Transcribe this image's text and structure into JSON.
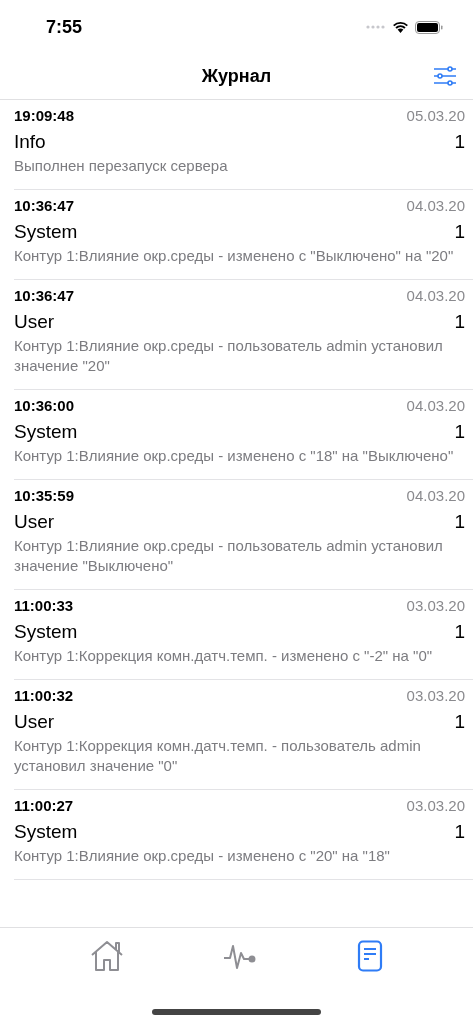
{
  "status_bar": {
    "time": "7:55"
  },
  "nav": {
    "title": "Журнал"
  },
  "entries": [
    {
      "time": "19:09:48",
      "date": "05.03.20",
      "category": "Info",
      "count": "1",
      "message": "Выполнен перезапуск сервера"
    },
    {
      "time": "10:36:47",
      "date": "04.03.20",
      "category": "System",
      "count": "1",
      "message": "Контур 1:Влияние окр.среды - изменено с \"Выключено\" на \"20\""
    },
    {
      "time": "10:36:47",
      "date": "04.03.20",
      "category": "User",
      "count": "1",
      "message": "Контур 1:Влияние окр.среды - пользователь admin установил значение \"20\""
    },
    {
      "time": "10:36:00",
      "date": "04.03.20",
      "category": "System",
      "count": "1",
      "message": "Контур 1:Влияние окр.среды - изменено с \"18\" на \"Выключено\""
    },
    {
      "time": "10:35:59",
      "date": "04.03.20",
      "category": "User",
      "count": "1",
      "message": "Контур 1:Влияние окр.среды - пользователь admin установил значение \"Выключено\""
    },
    {
      "time": "11:00:33",
      "date": "03.03.20",
      "category": "System",
      "count": "1",
      "message": "Контур 1:Коррекция комн.датч.темп. - изменено с \"-2\" на \"0\""
    },
    {
      "time": "11:00:32",
      "date": "03.03.20",
      "category": "User",
      "count": "1",
      "message": "Контур 1:Коррекция комн.датч.темп. - пользователь admin установил значение \"0\""
    },
    {
      "time": "11:00:27",
      "date": "03.03.20",
      "category": "System",
      "count": "1",
      "message": "Контур 1:Влияние окр.среды - изменено с \"20\" на \"18\""
    }
  ],
  "tabs": [
    {
      "kind": "home",
      "selected": false
    },
    {
      "kind": "activity",
      "selected": false
    },
    {
      "kind": "journal",
      "selected": true
    }
  ]
}
